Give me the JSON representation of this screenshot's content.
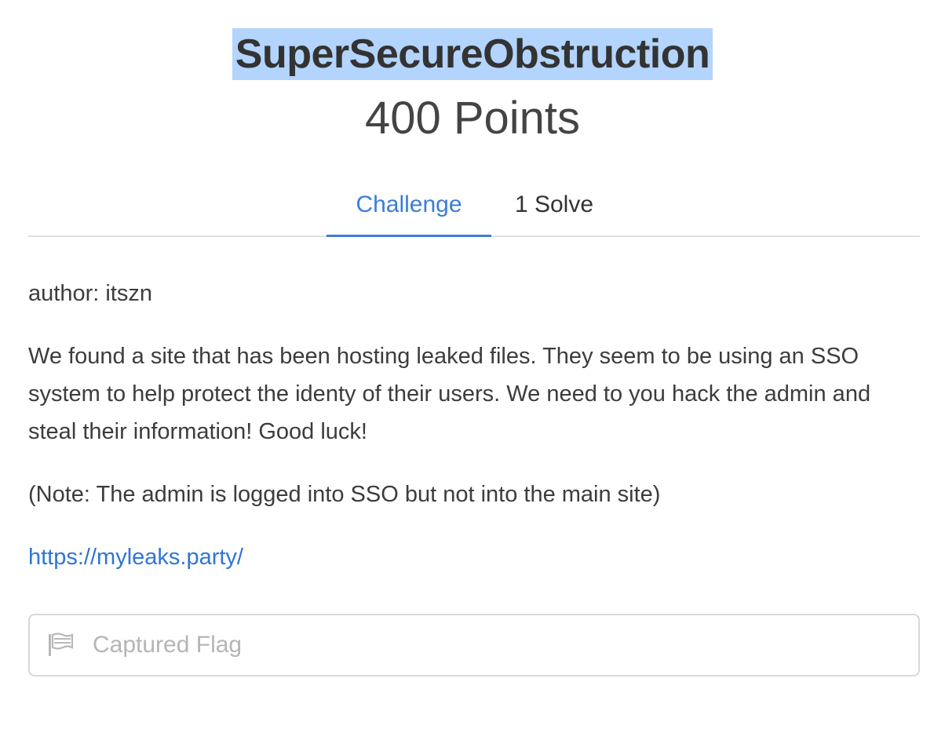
{
  "challenge": {
    "name": "SuperSecureObstruction",
    "points": "400 Points"
  },
  "tabs": {
    "challenge": "Challenge",
    "solves": "1 Solve"
  },
  "description": {
    "author": "author: itszn",
    "body": "We found a site that has been hosting leaked files. They seem to be using an SSO system to help protect the identy of their users. We need to you hack the admin and steal their information! Good luck!",
    "note": "(Note: The admin is logged into SSO but not into the main site)",
    "link_text": "https://myleaks.party/"
  },
  "flag_input": {
    "placeholder": "Captured Flag",
    "value": "",
    "icon": "flag-icon"
  },
  "colors": {
    "accent": "#3b7dd8",
    "link": "#2f75d6",
    "selection_highlight": "#b3d4fc",
    "text": "#3c3c3c",
    "placeholder": "#b5b5b5"
  }
}
